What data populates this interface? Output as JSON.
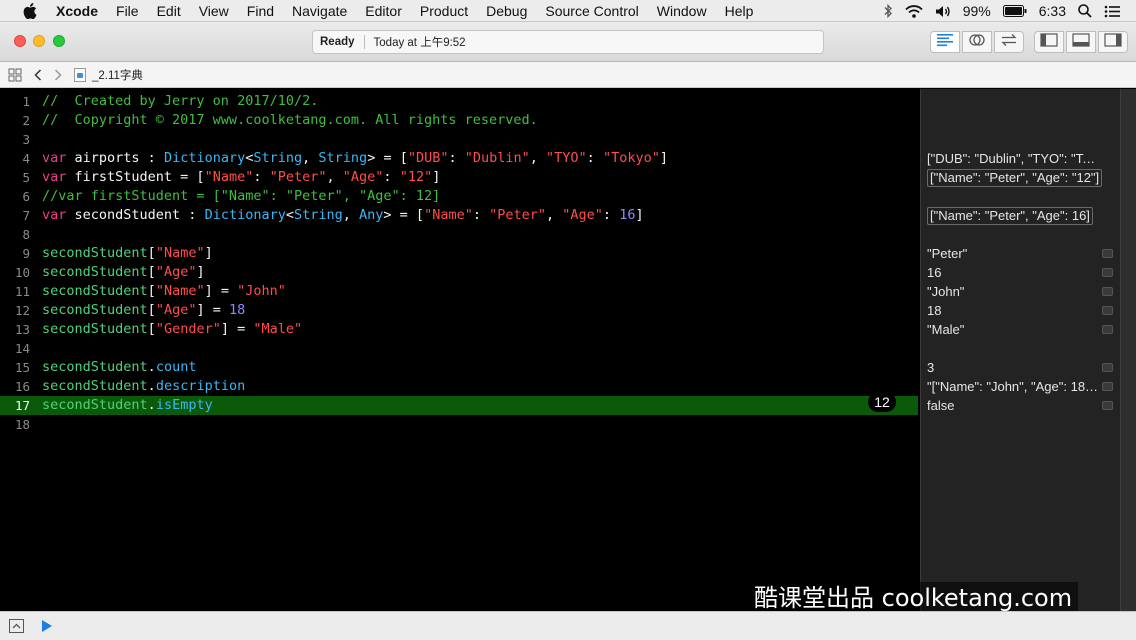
{
  "menubar": {
    "items": [
      "Xcode",
      "File",
      "Edit",
      "View",
      "Find",
      "Navigate",
      "Editor",
      "Product",
      "Debug",
      "Source Control",
      "Window",
      "Help"
    ],
    "battery": "99%",
    "time": "6:33"
  },
  "toolbar": {
    "activity_status": "Ready",
    "activity_detail": "Today at 上午9:52"
  },
  "jumpbar": {
    "file_name": "_2.11字典"
  },
  "editor": {
    "lines": [
      {
        "n": "1",
        "tokens": [
          {
            "t": "//  Created by Jerry on 2017/10/2.",
            "c": "comment"
          }
        ]
      },
      {
        "n": "2",
        "tokens": [
          {
            "t": "//  Copyright © 2017 www.coolketang.com. All rights reserved.",
            "c": "comment"
          }
        ]
      },
      {
        "n": "3",
        "tokens": []
      },
      {
        "n": "4",
        "tokens": [
          {
            "t": "var",
            "c": "kw"
          },
          {
            "t": " airports : ",
            "c": "plain"
          },
          {
            "t": "Dictionary",
            "c": "type"
          },
          {
            "t": "<",
            "c": "plain"
          },
          {
            "t": "String",
            "c": "type"
          },
          {
            "t": ", ",
            "c": "plain"
          },
          {
            "t": "String",
            "c": "type"
          },
          {
            "t": "> = [",
            "c": "plain"
          },
          {
            "t": "\"DUB\"",
            "c": "str"
          },
          {
            "t": ": ",
            "c": "plain"
          },
          {
            "t": "\"Dublin\"",
            "c": "str"
          },
          {
            "t": ", ",
            "c": "plain"
          },
          {
            "t": "\"TYO\"",
            "c": "str"
          },
          {
            "t": ": ",
            "c": "plain"
          },
          {
            "t": "\"Tokyo\"",
            "c": "str"
          },
          {
            "t": "]",
            "c": "plain"
          }
        ]
      },
      {
        "n": "5",
        "tokens": [
          {
            "t": "var",
            "c": "kw"
          },
          {
            "t": " firstStudent = [",
            "c": "plain"
          },
          {
            "t": "\"Name\"",
            "c": "str"
          },
          {
            "t": ": ",
            "c": "plain"
          },
          {
            "t": "\"Peter\"",
            "c": "str"
          },
          {
            "t": ", ",
            "c": "plain"
          },
          {
            "t": "\"Age\"",
            "c": "str"
          },
          {
            "t": ": ",
            "c": "plain"
          },
          {
            "t": "\"12\"",
            "c": "str"
          },
          {
            "t": "]",
            "c": "plain"
          }
        ]
      },
      {
        "n": "6",
        "tokens": [
          {
            "t": "//var firstStudent = [\"Name\": \"Peter\", \"Age\": 12]",
            "c": "comment"
          }
        ]
      },
      {
        "n": "7",
        "tokens": [
          {
            "t": "var",
            "c": "kw"
          },
          {
            "t": " secondStudent : ",
            "c": "plain"
          },
          {
            "t": "Dictionary",
            "c": "type"
          },
          {
            "t": "<",
            "c": "plain"
          },
          {
            "t": "String",
            "c": "type"
          },
          {
            "t": ", ",
            "c": "plain"
          },
          {
            "t": "Any",
            "c": "type"
          },
          {
            "t": "> = [",
            "c": "plain"
          },
          {
            "t": "\"Name\"",
            "c": "str"
          },
          {
            "t": ": ",
            "c": "plain"
          },
          {
            "t": "\"Peter\"",
            "c": "str"
          },
          {
            "t": ", ",
            "c": "plain"
          },
          {
            "t": "\"Age\"",
            "c": "str"
          },
          {
            "t": ": ",
            "c": "plain"
          },
          {
            "t": "16",
            "c": "num"
          },
          {
            "t": "]",
            "c": "plain"
          }
        ]
      },
      {
        "n": "8",
        "tokens": []
      },
      {
        "n": "9",
        "tokens": [
          {
            "t": "secondStudent",
            "c": "var"
          },
          {
            "t": "[",
            "c": "plain"
          },
          {
            "t": "\"Name\"",
            "c": "str"
          },
          {
            "t": "]",
            "c": "plain"
          }
        ]
      },
      {
        "n": "10",
        "tokens": [
          {
            "t": "secondStudent",
            "c": "var"
          },
          {
            "t": "[",
            "c": "plain"
          },
          {
            "t": "\"Age\"",
            "c": "str"
          },
          {
            "t": "]",
            "c": "plain"
          }
        ]
      },
      {
        "n": "11",
        "tokens": [
          {
            "t": "secondStudent",
            "c": "var"
          },
          {
            "t": "[",
            "c": "plain"
          },
          {
            "t": "\"Name\"",
            "c": "str"
          },
          {
            "t": "] = ",
            "c": "plain"
          },
          {
            "t": "\"John\"",
            "c": "str"
          }
        ]
      },
      {
        "n": "12",
        "tokens": [
          {
            "t": "secondStudent",
            "c": "var"
          },
          {
            "t": "[",
            "c": "plain"
          },
          {
            "t": "\"Age\"",
            "c": "str"
          },
          {
            "t": "] = ",
            "c": "plain"
          },
          {
            "t": "18",
            "c": "num"
          }
        ]
      },
      {
        "n": "13",
        "tokens": [
          {
            "t": "secondStudent",
            "c": "var"
          },
          {
            "t": "[",
            "c": "plain"
          },
          {
            "t": "\"Gender\"",
            "c": "str"
          },
          {
            "t": "] = ",
            "c": "plain"
          },
          {
            "t": "\"Male\"",
            "c": "str"
          }
        ]
      },
      {
        "n": "14",
        "tokens": []
      },
      {
        "n": "15",
        "tokens": [
          {
            "t": "secondStudent",
            "c": "var"
          },
          {
            "t": ".",
            "c": "plain"
          },
          {
            "t": "count",
            "c": "prop"
          }
        ]
      },
      {
        "n": "16",
        "tokens": [
          {
            "t": "secondStudent",
            "c": "var"
          },
          {
            "t": ".",
            "c": "plain"
          },
          {
            "t": "description",
            "c": "prop"
          }
        ]
      },
      {
        "n": "17",
        "tokens": [
          {
            "t": "secondStudent",
            "c": "var"
          },
          {
            "t": ".",
            "c": "plain"
          },
          {
            "t": "isEmpty",
            "c": "prop"
          }
        ],
        "highlighted": true
      },
      {
        "n": "18",
        "tokens": []
      }
    ],
    "line_badge": "12"
  },
  "results": [
    {
      "line": "4",
      "value": "[\"DUB\": \"Dublin\", \"TYO\": \"Tok...",
      "boxed": false,
      "quicklook": false
    },
    {
      "line": "5",
      "value": "[\"Name\": \"Peter\", \"Age\": \"12\"]",
      "boxed": true,
      "quicklook": false
    },
    {
      "line": "7",
      "value": "[\"Name\": \"Peter\", \"Age\": 16]",
      "boxed": true,
      "quicklook": false
    },
    {
      "line": "9",
      "value": "\"Peter\"",
      "boxed": false,
      "quicklook": true
    },
    {
      "line": "10",
      "value": "16",
      "boxed": false,
      "quicklook": true
    },
    {
      "line": "11",
      "value": "\"John\"",
      "boxed": false,
      "quicklook": true
    },
    {
      "line": "12",
      "value": "18",
      "boxed": false,
      "quicklook": true
    },
    {
      "line": "13",
      "value": "\"Male\"",
      "boxed": false,
      "quicklook": true
    },
    {
      "line": "15",
      "value": "3",
      "boxed": false,
      "quicklook": true
    },
    {
      "line": "16",
      "value": "\"[\"Name\": \"John\", \"Age\": 18,...",
      "boxed": false,
      "quicklook": true
    },
    {
      "line": "17",
      "value": "false",
      "boxed": false,
      "quicklook": true
    }
  ],
  "watermark": "酷课堂出品 coolketang.com",
  "colors": {
    "comment": "#3fbf3f",
    "keyword": "#f13c8c",
    "type": "#3ab7f5",
    "string": "#ff4c4c",
    "number": "#8a8aff",
    "variable": "#4fd27a",
    "highlight_line": "#0a5a0a"
  }
}
